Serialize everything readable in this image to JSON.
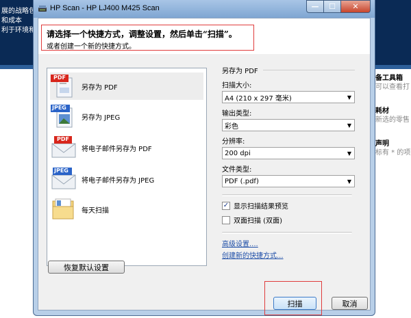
{
  "background": {
    "left_lines": [
      "展的战略包",
      "和成本",
      "利于环境和"
    ],
    "right_items": [
      {
        "title": "备工具箱",
        "sub": "可以查看打"
      },
      {
        "title": "耗材",
        "sub": "新选的零售"
      },
      {
        "title": "声明",
        "sub": "标有 * 的项"
      }
    ]
  },
  "window": {
    "title": "HP Scan - HP LJ400 M425 Scan",
    "min_glyph": "—",
    "max_glyph": "☐",
    "close_glyph": "✕"
  },
  "header": {
    "main": "请选择一个快捷方式，调整设置，然后单击“扫描”。",
    "sub": "或者创建一个新的快捷方式。"
  },
  "shortcuts": [
    {
      "label": "另存为 PDF",
      "icon": "pdf-document-icon",
      "badge": "PDF",
      "badge_color": "#d8261c"
    },
    {
      "label": "另存为 JPEG",
      "icon": "jpeg-document-icon",
      "badge": "JPEG",
      "badge_color": "#2a63c8"
    },
    {
      "label": "将电子邮件另存为 PDF",
      "icon": "pdf-envelope-icon",
      "badge": "PDF",
      "badge_color": "#d8261c"
    },
    {
      "label": "将电子邮件另存为 JPEG",
      "icon": "jpeg-envelope-icon",
      "badge": "JPEG",
      "badge_color": "#2a63c8"
    },
    {
      "label": "每天扫描",
      "icon": "folder-icon"
    }
  ],
  "restore_button": "恢复默认设置",
  "settings": {
    "section_title": "另存为 PDF",
    "scan_size_label": "扫描大小:",
    "scan_size_value": "A4 (210 x 297 毫米)",
    "output_type_label": "输出类型:",
    "output_type_value": "彩色",
    "resolution_label": "分辨率:",
    "resolution_value": "200 dpi",
    "file_type_label": "文件类型:",
    "file_type_value": "PDF (.pdf)",
    "preview_label": "显示扫描结果预览",
    "preview_checked": true,
    "duplex_label": "双面扫描 (双面)",
    "duplex_checked": false,
    "check_glyph": "✓",
    "advanced_link": "高级设置....",
    "create_link": "创建新的快捷方式..."
  },
  "buttons": {
    "scan": "扫描",
    "cancel": "取消"
  },
  "colors": {
    "highlight": "#e03a3a",
    "link": "#1f4fa8",
    "title_bar": "#a8c5e6"
  }
}
